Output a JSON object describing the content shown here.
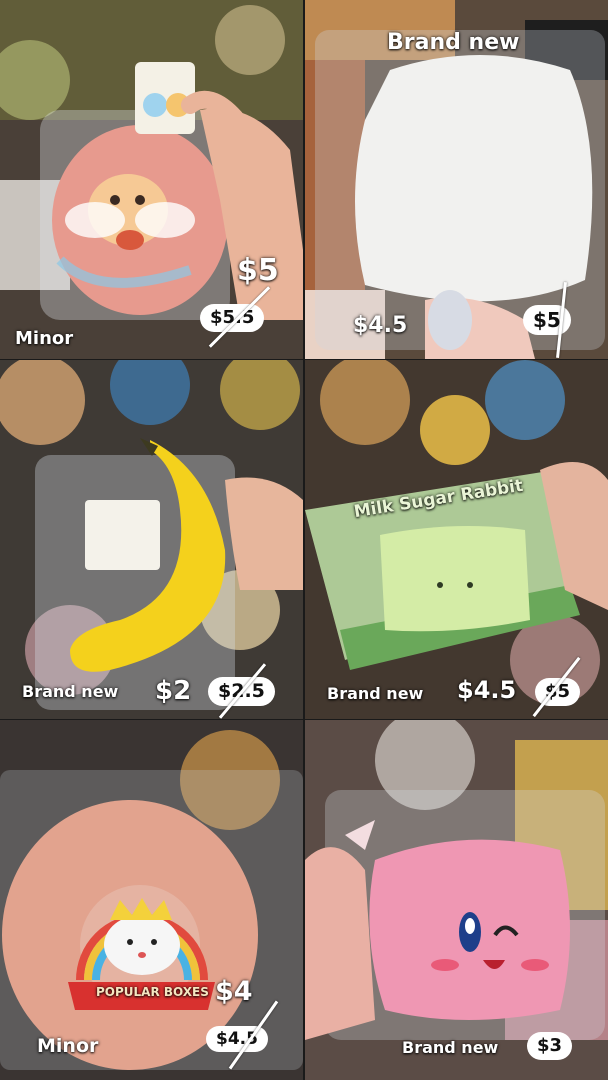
{
  "panels": [
    {
      "condition": "Minor",
      "price": "$5",
      "original_price": "$5.5"
    },
    {
      "condition": "Brand new",
      "price": "$4.5",
      "original_price": "$5"
    },
    {
      "condition": "Brand new",
      "price": "$2",
      "original_price": "$2.5"
    },
    {
      "condition": "Brand new",
      "price": "$4.5",
      "original_price": "$5"
    },
    {
      "condition": "Minor",
      "price": "$4",
      "original_price": "$4.5"
    },
    {
      "condition": "Brand new",
      "price": "$3"
    }
  ],
  "packaging_text": {
    "milk_sugar_rabbit": "Milk Sugar Rabbit",
    "popular_boxes": "POPULAR BOXES"
  }
}
